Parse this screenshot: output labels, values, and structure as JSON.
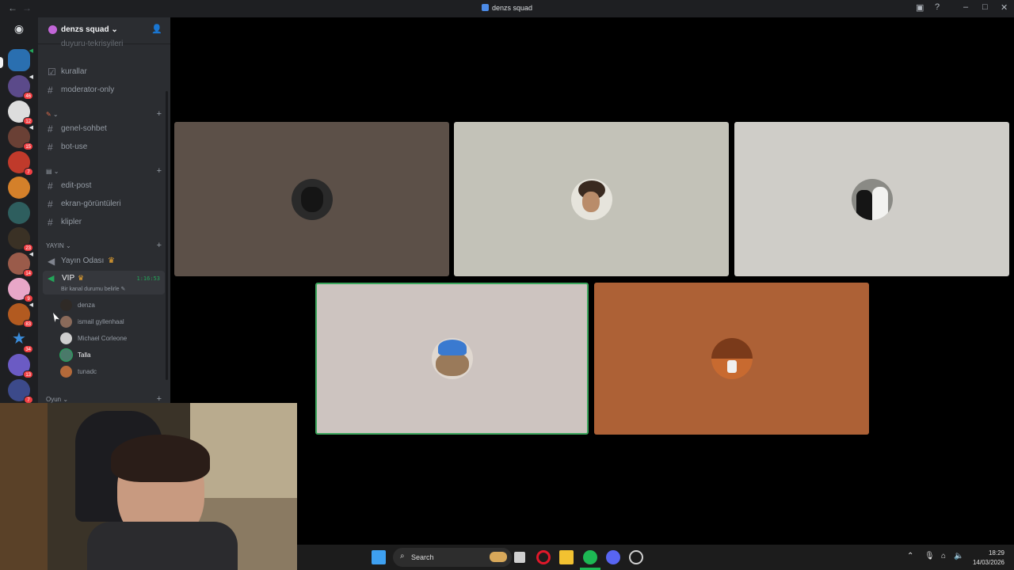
{
  "window": {
    "title": "denzs squad"
  },
  "server": {
    "name": "denzs squad"
  },
  "channels": {
    "top_partial": "duyuru-tekrisyileri",
    "rules": "kurallar",
    "moderator_only": "moderator-only",
    "genel_sohbet": "genel-sohbet",
    "bot_use": "bot-use",
    "edit_post": "edit-post",
    "ekran": "ekran-görüntüleri",
    "klipler": "klipler"
  },
  "categories": {
    "yayin": "YAYIN",
    "oyun": "Oyun"
  },
  "voice": {
    "yayin_odasi": "Yayın Odası",
    "vip": "VIP",
    "vip_time": "1:16:53",
    "vip_status": "Bir kanal durumu belirle",
    "members": [
      "denza",
      "ismail gyllenhaal",
      "Michael Corleone",
      "Talla",
      "tunadc"
    ]
  },
  "guild_badges": [
    "46",
    "12",
    "15",
    "7",
    "23",
    "14",
    "9",
    "83",
    "34",
    "13",
    "7"
  ],
  "taskbar": {
    "search_label": "Search",
    "time": "18:29",
    "date": "14/03/2026"
  },
  "colors": {
    "sidebar": "#2b2d31",
    "rail": "#1e1f22",
    "speaking": "#3ba55c",
    "accent": "#5865f2"
  }
}
